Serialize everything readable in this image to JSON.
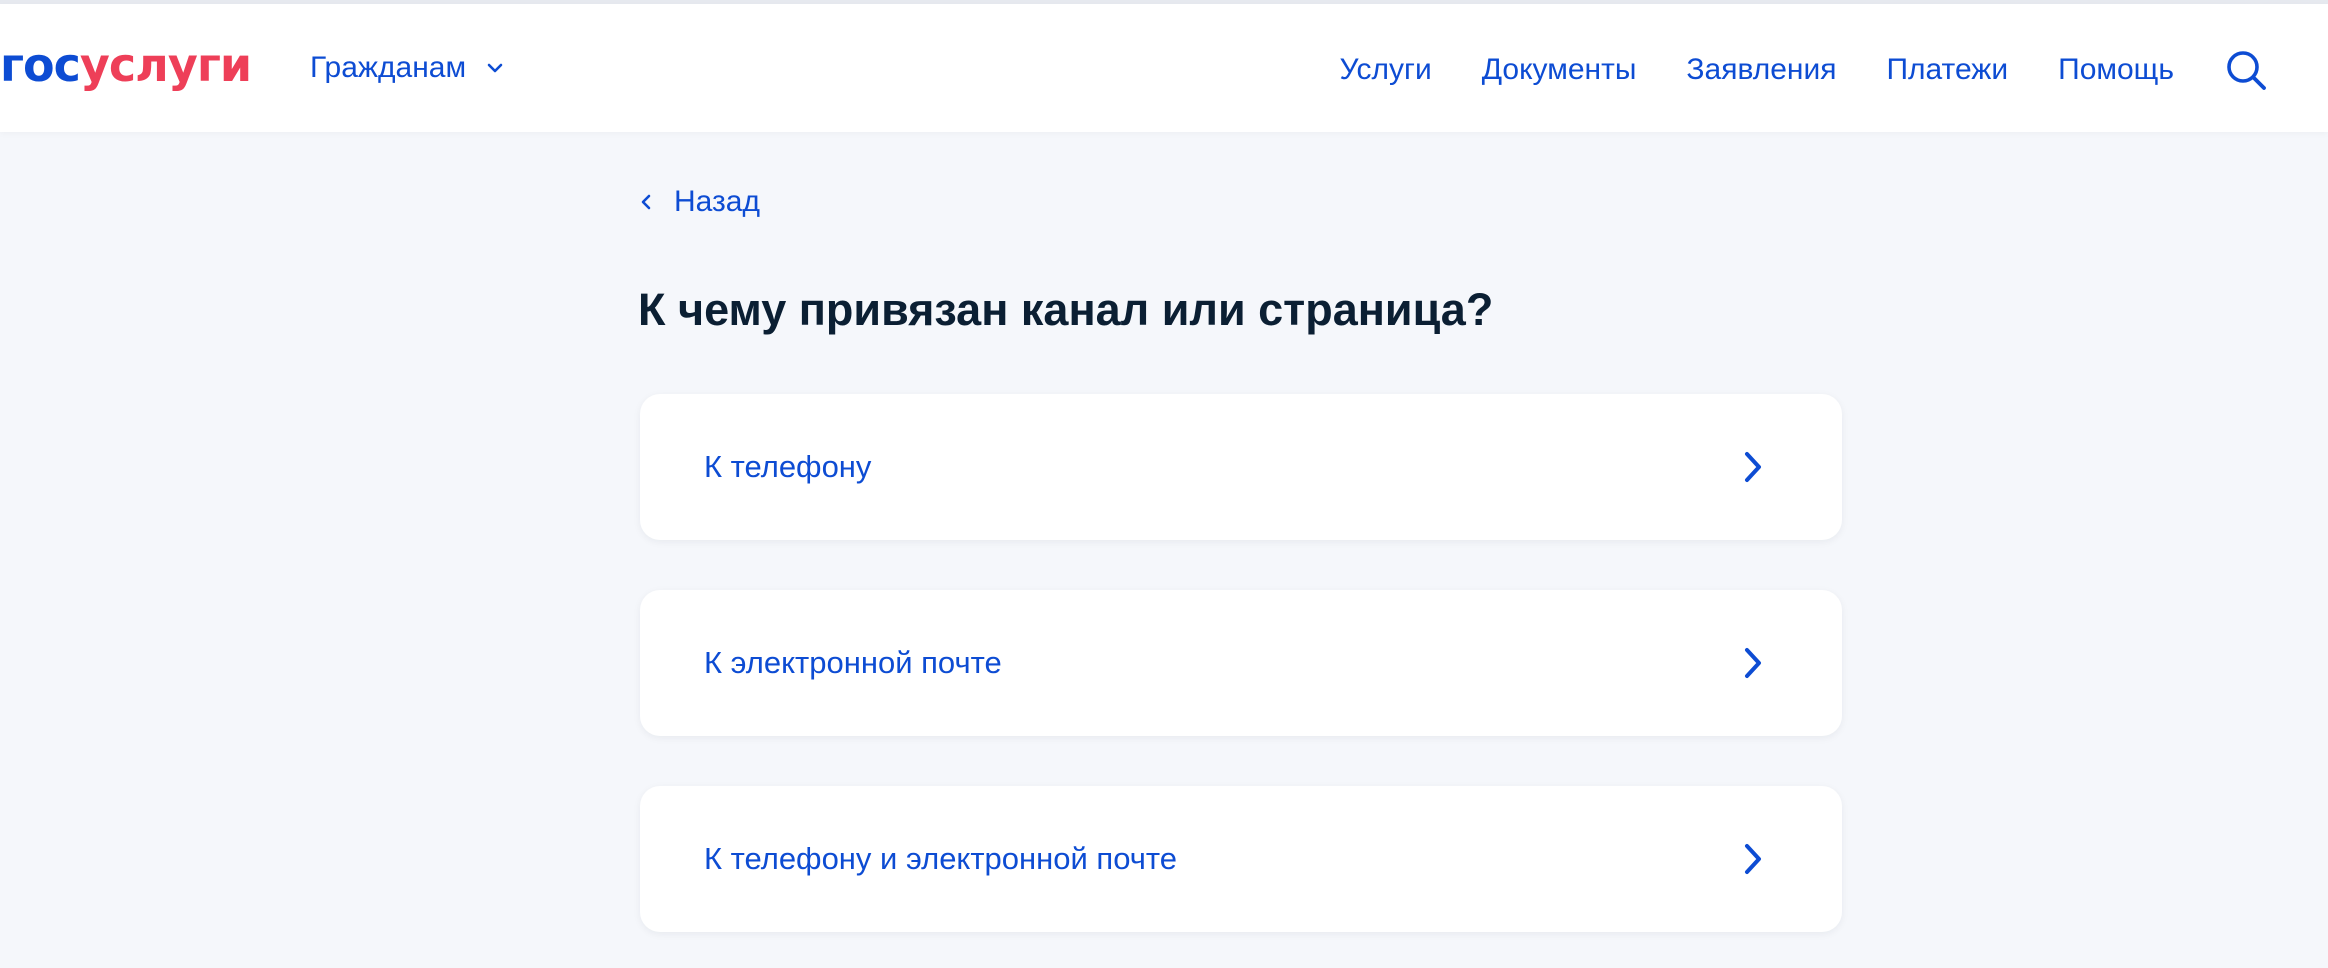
{
  "header": {
    "logo_part1": "гос",
    "logo_part2": "услуги",
    "citizens_label": "Гражданам",
    "nav": [
      {
        "label": "Услуги"
      },
      {
        "label": "Документы"
      },
      {
        "label": "Заявления"
      },
      {
        "label": "Платежи"
      },
      {
        "label": "Помощь"
      }
    ],
    "search_icon": "search-icon"
  },
  "main": {
    "back_label": "Назад",
    "title": "К чему привязан канал или страница?",
    "options": [
      {
        "label": "К телефону",
        "icon": "chevron-right-icon"
      },
      {
        "label": "К электронной почте",
        "icon": "chevron-right-icon"
      },
      {
        "label": "К телефону и электронной почте",
        "icon": "chevron-right-icon"
      }
    ]
  },
  "colors": {
    "accent": "#0d4cd3",
    "brand_red": "#ee3f58",
    "background": "#f5f7fb",
    "text_dark": "#0b1f33"
  }
}
